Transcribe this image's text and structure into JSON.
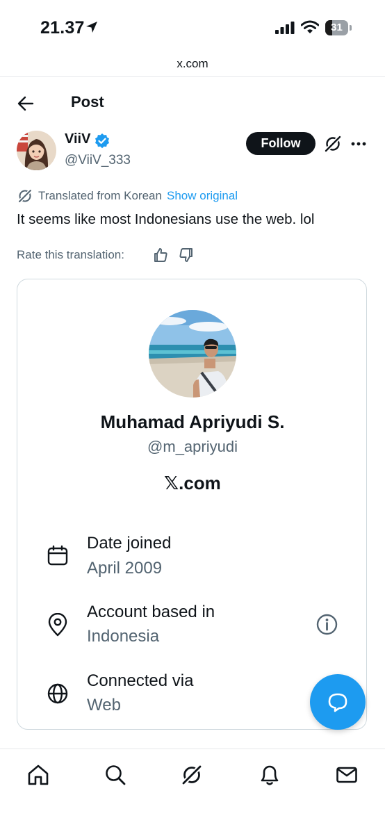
{
  "status_bar": {
    "time": "21.37",
    "battery": "31",
    "battery_level": 0.31
  },
  "browser": {
    "url": "x.com"
  },
  "header": {
    "title": "Post"
  },
  "post": {
    "author_name": "ViiV",
    "author_handle": "@ViiV_333",
    "follow_label": "Follow",
    "translated_label": "Translated from Korean",
    "show_original_label": "Show original",
    "text": "It seems like most Indonesians use the web. lol",
    "rate_label": "Rate this translation:"
  },
  "card": {
    "name": "Muhamad Apriyudi S.",
    "handle": "@m_apriyudi",
    "site": "𝕏.com",
    "rows": [
      {
        "label": "Date joined",
        "value": "April 2009",
        "icon": "calendar-icon"
      },
      {
        "label": "Account based in",
        "value": "Indonesia",
        "icon": "location-pin-icon"
      },
      {
        "label": "Connected via",
        "value": "Web",
        "icon": "globe-icon"
      }
    ]
  },
  "nav": [
    "home-icon",
    "search-icon",
    "grok-icon",
    "notifications-icon",
    "messages-icon"
  ],
  "colors": {
    "accent": "#1d9bf0",
    "text": "#0f1419",
    "secondary": "#536471"
  }
}
